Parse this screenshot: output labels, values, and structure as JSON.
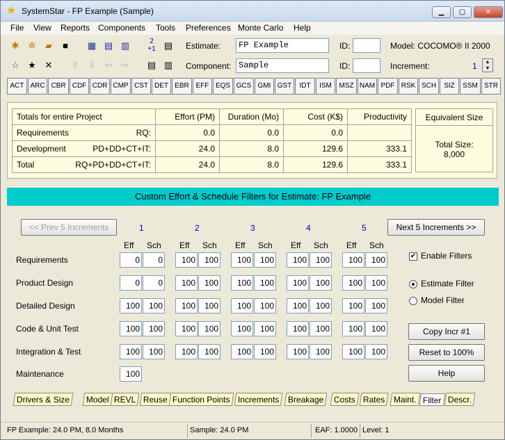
{
  "window": {
    "title": "SystemStar - FP Example (Sample)"
  },
  "menu": [
    "File",
    "Edit",
    "View",
    "Reports",
    "Components",
    "Tools",
    "Preferences",
    "Monte Carlo",
    "Help"
  ],
  "toolbar": {
    "estimate_label": "Estimate:",
    "estimate_value": "FP Example",
    "id_label": "ID:",
    "id_value": "",
    "model_label": "Model: COCOMO® II 2000",
    "component_label": "Component:",
    "component_value": "Sample",
    "id2_label": "ID:",
    "id2_value": "",
    "increment_label": "Increment:",
    "increment_value": "1",
    "incr_icon_top": "2",
    "incr_icon_bottom": "+1"
  },
  "modules": [
    "ACT",
    "ARC",
    "CBR",
    "CDF",
    "CDR",
    "CMP",
    "CST",
    "DET",
    "EBR",
    "EFF",
    "EQS",
    "GCS",
    "GMI",
    "GST",
    "IDT",
    "ISM",
    "MSZ",
    "NAM",
    "PDF",
    "RSK",
    "SCH",
    "SIZ",
    "SSM",
    "STR"
  ],
  "summary": {
    "header": [
      "Totals for entire Project",
      "Effort (PM)",
      "Duration (Mo)",
      "Cost (K$)",
      "Productivity"
    ],
    "rows": [
      {
        "name": "Requirements",
        "code": "RQ:",
        "effort": "0.0",
        "duration": "0.0",
        "cost": "0.0",
        "productivity": ""
      },
      {
        "name": "Development",
        "code": "PD+DD+CT+IT:",
        "effort": "24.0",
        "duration": "8.0",
        "cost": "129.6",
        "productivity": "333.1"
      },
      {
        "name": "Total",
        "code": "RQ+PD+DD+CT+IT:",
        "effort": "24.0",
        "duration": "8.0",
        "cost": "129.6",
        "productivity": "333.1"
      }
    ],
    "equiv_title": "Equivalent Size",
    "total_size_label": "Total Size:",
    "total_size_value": "8,000"
  },
  "filters": {
    "banner": "Custom Effort & Schedule Filters for Estimate: FP Example",
    "prev_button": "<< Prev 5 Increments",
    "next_button": "Next 5 Increments >>",
    "increments": [
      "1",
      "2",
      "3",
      "4",
      "5"
    ],
    "eff_label": "Eff",
    "sch_label": "Sch",
    "phases": [
      {
        "label": "Requirements",
        "values": [
          [
            "0",
            "0"
          ],
          [
            "100",
            "100"
          ],
          [
            "100",
            "100"
          ],
          [
            "100",
            "100"
          ],
          [
            "100",
            "100"
          ]
        ]
      },
      {
        "label": "Product Design",
        "values": [
          [
            "0",
            "0"
          ],
          [
            "100",
            "100"
          ],
          [
            "100",
            "100"
          ],
          [
            "100",
            "100"
          ],
          [
            "100",
            "100"
          ]
        ]
      },
      {
        "label": "Detailed Design",
        "values": [
          [
            "100",
            "100"
          ],
          [
            "100",
            "100"
          ],
          [
            "100",
            "100"
          ],
          [
            "100",
            "100"
          ],
          [
            "100",
            "100"
          ]
        ]
      },
      {
        "label": "Code & Unit Test",
        "values": [
          [
            "100",
            "100"
          ],
          [
            "100",
            "100"
          ],
          [
            "100",
            "100"
          ],
          [
            "100",
            "100"
          ],
          [
            "100",
            "100"
          ]
        ]
      },
      {
        "label": "Integration & Test",
        "values": [
          [
            "100",
            "100"
          ],
          [
            "100",
            "100"
          ],
          [
            "100",
            "100"
          ],
          [
            "100",
            "100"
          ],
          [
            "100",
            "100"
          ]
        ]
      }
    ],
    "maintenance_label": "Maintenance",
    "maintenance_value": "100",
    "enable_label": "Enable Filters",
    "estimate_filter_label": "Estimate Filter",
    "model_filter_label": "Model Filter",
    "copy_button": "Copy Incr #1",
    "reset_button": "Reset to 100%",
    "help_button": "Help"
  },
  "tabs": [
    "Drivers & Size",
    "Model",
    "REVL",
    "Reuse",
    "Function Points",
    "Increments",
    "Breakage",
    "Costs",
    "Rates",
    "Maint.",
    "Filter",
    "Descr."
  ],
  "active_tab": "Filter",
  "status": {
    "left": "FP Example:  24.0 PM,  8.0 Months",
    "mid": "Sample:  24.0 PM",
    "eaf": "EAF: 1.0000",
    "level": "Level:   1"
  }
}
